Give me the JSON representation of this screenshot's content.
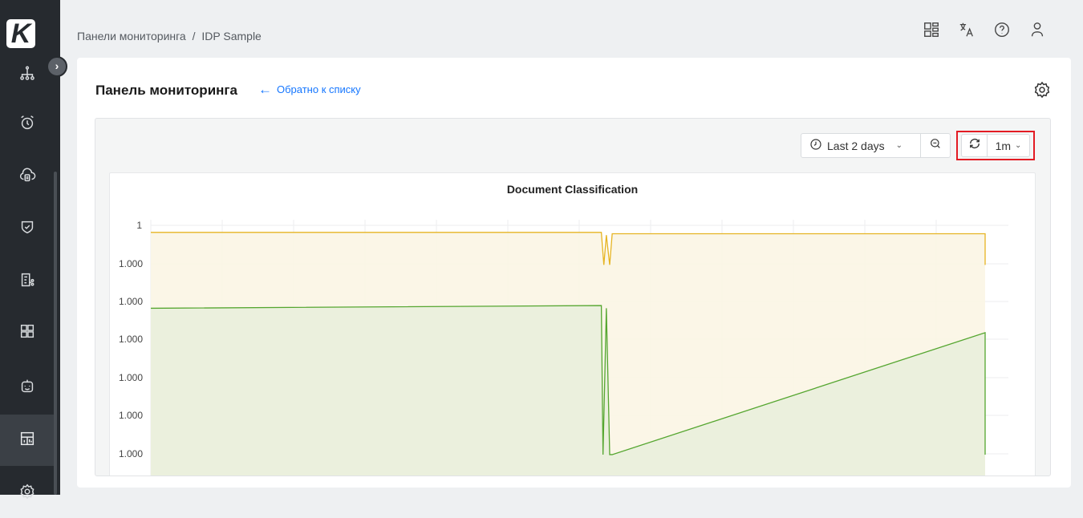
{
  "app": {
    "logo_letter": "K"
  },
  "breadcrumb": {
    "root": "Панели мониторинга",
    "separator": "/",
    "current": "IDP Sample"
  },
  "sidebar": {
    "toggle_icon": "chevron-right-icon",
    "items": [
      {
        "icon": "hierarchy-icon"
      },
      {
        "icon": "alarm-clock-icon"
      },
      {
        "icon": "cloud-icon"
      },
      {
        "icon": "shield-check-icon"
      },
      {
        "icon": "document-flow-icon"
      },
      {
        "icon": "grid-icon"
      },
      {
        "icon": "robot-icon"
      },
      {
        "icon": "dashboard-icon",
        "active": true
      },
      {
        "icon": "gear-icon"
      }
    ]
  },
  "top_icons": [
    "apps-icon",
    "translate-icon",
    "help-icon",
    "user-icon"
  ],
  "page": {
    "title": "Панель мониторинга",
    "back_link": "Обратно к списку"
  },
  "toolbar": {
    "time_range": "Last 2 days",
    "refresh_interval": "1m"
  },
  "colors": {
    "accent": "#1677ff",
    "highlight": "#e31b23",
    "series_yellow": "#e6b422",
    "series_green": "#55a630"
  },
  "chart_data": {
    "type": "area",
    "title": "Document Classification",
    "y_tick_labels": [
      "1",
      "1.000",
      "1.000",
      "1.000",
      "1.000",
      "1.000",
      "1.000"
    ],
    "xlabel": "",
    "ylabel": "",
    "grid": true,
    "series": [
      {
        "color": "#e6b422",
        "x": [
          0,
          54,
          54.3,
          54.6,
          55,
          55.3,
          100,
          100
        ],
        "values": [
          0.9,
          0.9,
          0.78,
          0.89,
          0.78,
          0.895,
          0.895,
          0.78
        ]
      },
      {
        "color": "#55a630",
        "x": [
          0,
          54,
          54.2,
          54.6,
          55,
          55.3,
          100,
          100
        ],
        "values": [
          0.62,
          0.63,
          0.08,
          0.62,
          0.08,
          0.08,
          0.53,
          0.08
        ]
      }
    ],
    "ylim": [
      0,
      1
    ]
  }
}
